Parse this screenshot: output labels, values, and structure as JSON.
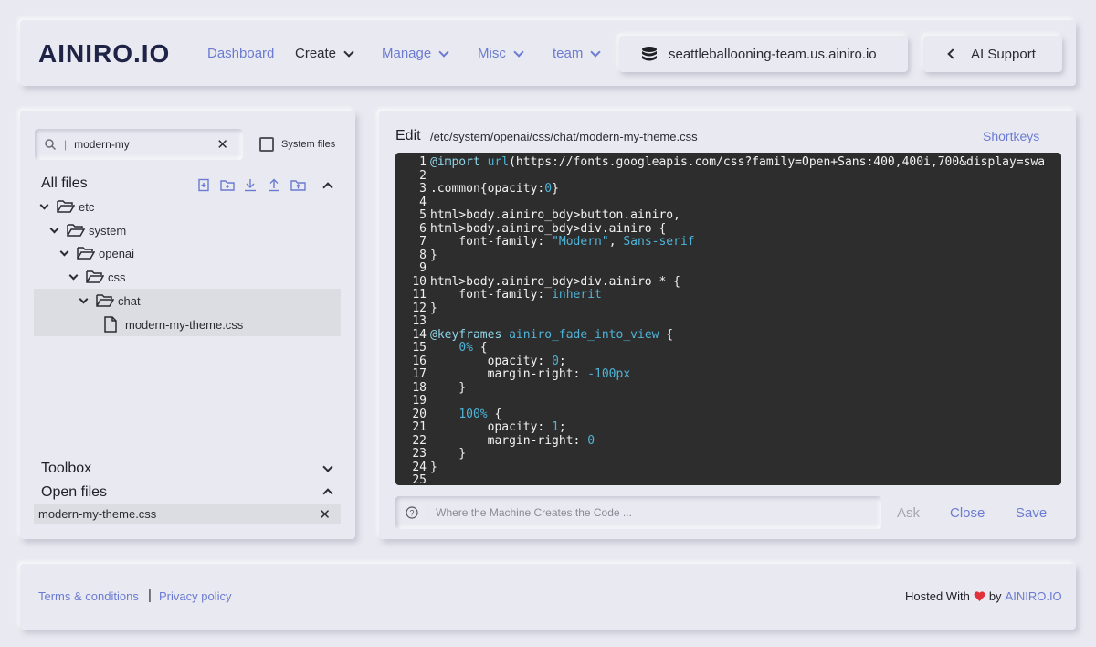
{
  "header": {
    "logo": "AINIRO.IO",
    "nav": {
      "dashboard": "Dashboard",
      "create": "Create",
      "manage": "Manage",
      "misc": "Misc",
      "team": "team"
    },
    "server": "seattleballooning-team.us.ainiro.io",
    "support": "AI Support"
  },
  "sidebar": {
    "search_value": "modern-my",
    "system_files_label": "System files",
    "all_files_title": "All files",
    "tree": [
      {
        "label": "etc"
      },
      {
        "label": "system"
      },
      {
        "label": "openai"
      },
      {
        "label": "css"
      },
      {
        "label": "chat"
      },
      {
        "label": "modern-my-theme.css"
      }
    ],
    "toolbox_title": "Toolbox",
    "open_files_title": "Open files",
    "open_files": [
      {
        "label": "modern-my-theme.css"
      }
    ]
  },
  "editor": {
    "title": "Edit",
    "path": "/etc/system/openai/css/chat/modern-my-theme.css",
    "shortkeys": "Shortkeys",
    "lines": [
      "@import url(https://fonts.googleapis.com/css?family=Open+Sans:400,400i,700&display=swa",
      "",
      ".common{opacity:0}",
      "",
      "html>body.ainiro_bdy>button.ainiro,",
      "html>body.ainiro_bdy>div.ainiro {",
      "    font-family: \"Modern\", Sans-serif",
      "}",
      "",
      "html>body.ainiro_bdy>div.ainiro * {",
      "    font-family: inherit",
      "}",
      "",
      "@keyframes ainiro_fade_into_view {",
      "    0% {",
      "        opacity: 0;",
      "        margin-right: -100px",
      "    }",
      "",
      "    100% {",
      "        opacity: 1;",
      "        margin-right: 0",
      "    }",
      "}",
      ""
    ],
    "ask_placeholder": "Where the Machine Creates the Code ...",
    "ask_button": "Ask",
    "close_button": "Close",
    "save_button": "Save"
  },
  "footer": {
    "terms": "Terms & conditions",
    "separator": "|",
    "privacy": "Privacy policy",
    "hosted_prefix": "Hosted With",
    "hosted_by": "by",
    "brand": "AINIRO.IO"
  },
  "colors": {
    "accent": "#6b7bd1",
    "background": "#e9eaf1",
    "editor_bg": "#2d2d2d",
    "heart": "#e0323a"
  }
}
